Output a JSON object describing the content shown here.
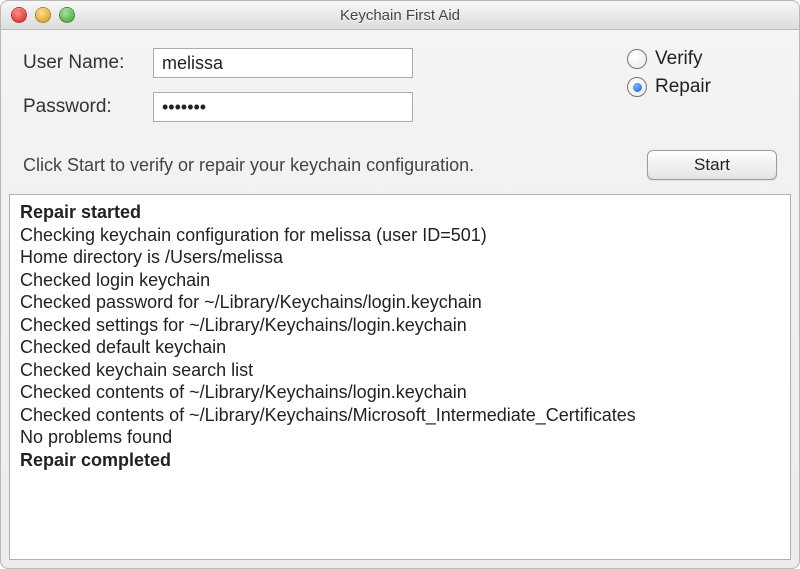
{
  "window": {
    "title": "Keychain First Aid"
  },
  "form": {
    "username_label": "User Name:",
    "username_value": "melissa",
    "password_label": "Password:",
    "password_display": "•••••••",
    "instruction": "Click Start to verify or repair your keychain configuration."
  },
  "mode": {
    "verify_label": "Verify",
    "repair_label": "Repair",
    "selected": "repair"
  },
  "actions": {
    "start_label": "Start"
  },
  "log": {
    "lines": [
      {
        "text": "Repair started",
        "bold": true
      },
      {
        "text": "Checking keychain configuration for melissa (user ID=501)"
      },
      {
        "text": "Home directory is /Users/melissa"
      },
      {
        "text": "Checked login keychain"
      },
      {
        "text": "Checked password for ~/Library/Keychains/login.keychain"
      },
      {
        "text": "Checked settings for ~/Library/Keychains/login.keychain"
      },
      {
        "text": "Checked default keychain"
      },
      {
        "text": "Checked keychain search list"
      },
      {
        "text": "Checked contents of ~/Library/Keychains/login.keychain"
      },
      {
        "text": "Checked contents of ~/Library/Keychains/Microsoft_Intermediate_Certificates"
      },
      {
        "text": "No problems found"
      },
      {
        "text": "Repair completed",
        "bold": true
      }
    ]
  }
}
